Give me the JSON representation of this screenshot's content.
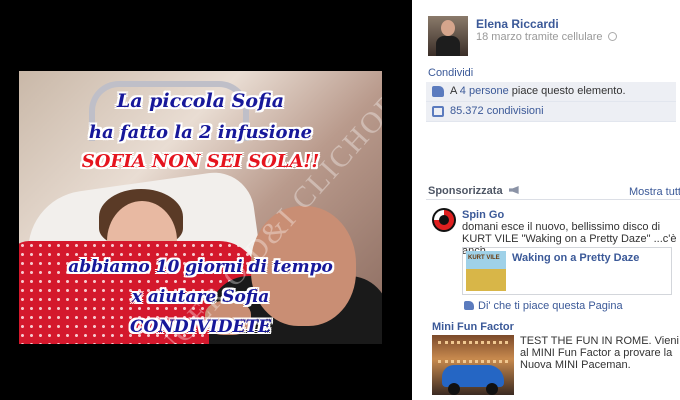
{
  "photo": {
    "caption_line1": "La piccola Sofia",
    "caption_line2": "ha fatto la 2 infusione",
    "caption_line3": "SOFIA NON SEI SOLA!!",
    "caption_line4": "abbiamo 10 giorni di tempo",
    "caption_line5": "x aiutare Sofia",
    "caption_line6": "CONDIVIDETE",
    "watermark": "SINGER O D&I CLICHOR"
  },
  "post": {
    "author": "Elena Riccardi",
    "meta": "18 marzo tramite cellulare",
    "share_label": "Condividi",
    "likes_prefix": "A ",
    "likes_link": "4 persone",
    "likes_suffix": " piace questo elemento.",
    "shares_text": "85.372 condivisioni"
  },
  "sponsored": {
    "title": "Sponsorizzata",
    "show_all": "Mostra tutte",
    "ads": [
      {
        "title": "Spin Go",
        "text": "domani esce il nuovo, bellissimo disco di KURT VILE \"Waking on a Pretty Daze\" ...c'è anch...",
        "box_title": "Waking on a Pretty Daze",
        "thumb_text": "KURT VILE",
        "like_label": "Di' che ti piace questa Pagina"
      },
      {
        "title": "Mini Fun Factor",
        "text": "TEST THE FUN IN ROME. Vieni al MINI Fun Factor a provare la Nuova MINI Paceman."
      }
    ]
  },
  "colors": {
    "link": "#3b5998",
    "caption_blue": "#17189a",
    "caption_red": "#e5141e",
    "feedback_bg": "#edeff4"
  },
  "icons": [
    "globe-icon",
    "thumb-icon",
    "share-icon",
    "megaphone-icon"
  ]
}
